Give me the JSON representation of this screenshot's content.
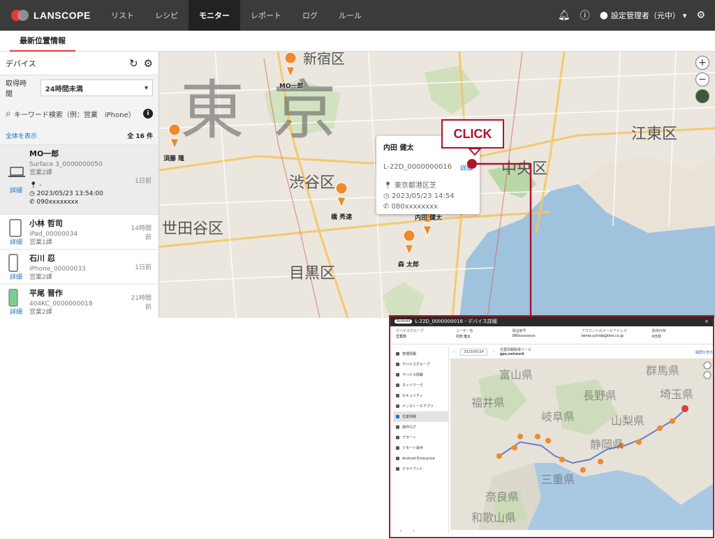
{
  "app": {
    "logo": "LANSCOPE",
    "nav": [
      "リスト",
      "レシピ",
      "モニター",
      "レポート",
      "ログ",
      "ルール"
    ],
    "nav_active": "モニター",
    "user": "設定管理者（元中）"
  },
  "tab": "最新位置情報",
  "sidebar": {
    "title": "デバイス",
    "filter_label": "取得時間",
    "filter_value": "24時間未満",
    "search_placeholder": "キーワード検索（例：営業　iPhone）",
    "show_all": "全体を表示",
    "count": "全 16 件",
    "detail_label": "詳細",
    "devices": [
      {
        "name": "MO一郎",
        "model": "Surface 3_0000000050",
        "group": "営業2課",
        "when": "1日前",
        "loc": "-",
        "time": "2023/05/23 13:54:00",
        "phone": "090xxxxxxxx"
      },
      {
        "name": "小林 哲司",
        "model": "iPad_00000034",
        "group": "営業1課",
        "when": "14時間前"
      },
      {
        "name": "石川 忍",
        "model": "iPhone_00000033",
        "group": "営業2課",
        "when": "1日前"
      },
      {
        "name": "平尾 晋作",
        "model": "404KC_0000000018",
        "group": "営業2課",
        "when": "21時間前"
      }
    ]
  },
  "map": {
    "big_text": "東京",
    "wards": [
      "新宿区",
      "渋谷区",
      "世田谷区",
      "目黒区",
      "中央区",
      "江東区"
    ],
    "pins": [
      "MO一郎",
      "須藤 隆",
      "橋 秀達",
      "内田 健太",
      "森 太郎"
    ],
    "popup": {
      "name": "内田 健太",
      "device_id": "L-22D_0000000016",
      "detail": "詳細",
      "location": "東京都港区芝",
      "time": "2023/05/23 14:54",
      "phone": "080xxxxxxxx"
    },
    "callout": "CLICK"
  },
  "inset": {
    "badge": "Android",
    "title": "L-22D_0000000016 - デバイス詳細",
    "info": [
      {
        "label": "デバイスグループ",
        "value": "営業部"
      },
      {
        "label": "ユーザー名",
        "value": "内田 健太"
      },
      {
        "label": "電話番号",
        "value": "080xxxxxxxx"
      },
      {
        "label": "アカウントのメールアドレス",
        "value": "kenta.uchida@test.co.jp"
      },
      {
        "label": "取得日時",
        "value": "6日前"
      }
    ],
    "menu": [
      "管理情報",
      "デバイスグループ",
      "デバイス情報",
      "ネットワーク",
      "セキュリティ",
      "インストールアプリ",
      "位置情報",
      "操作ログ",
      "アラート",
      "リモート操作",
      "Android Enterprise",
      "クライアント"
    ],
    "menu_active": "位置情報",
    "date": "2023/05/24",
    "source_label": "位置情報取得ソース",
    "source_value": "gps,network",
    "history_link": "履歴を表示",
    "prefectures": [
      "富山県",
      "群馬県",
      "福井県",
      "長野県",
      "埼玉県",
      "岐阜県",
      "山梨県",
      "静岡県",
      "三重県",
      "奈良県",
      "和歌山県"
    ]
  }
}
